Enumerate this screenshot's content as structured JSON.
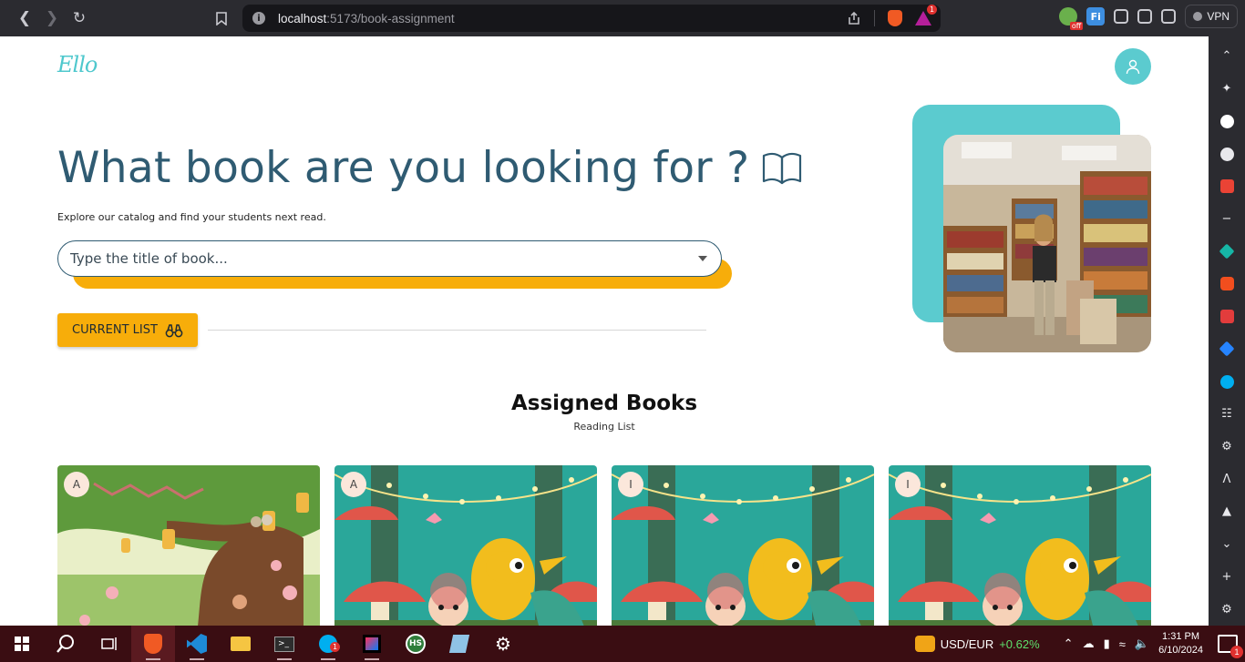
{
  "browser": {
    "url_host": "localhost",
    "url_rest": ":5173/book-assignment",
    "vpn_label": "VPN",
    "ext_off_badge": "off",
    "ext_fi_label": "Fi",
    "bat_badge": "1"
  },
  "app": {
    "logo": "Ello",
    "hero_title": "What book are you looking for ?",
    "hero_subtitle": "Explore our catalog and find your students next read.",
    "search_placeholder": "Type the title of book...",
    "current_list_label": "CURRENT LIST",
    "section_title": "Assigned Books",
    "section_subtitle": "Reading List",
    "books": [
      {
        "level": "A",
        "scene": "treehouse"
      },
      {
        "level": "A",
        "scene": "dragon"
      },
      {
        "level": "I",
        "scene": "dragon"
      },
      {
        "level": "I",
        "scene": "dragon"
      }
    ],
    "accent_teal": "#5bcbcf",
    "accent_yellow": "#f7ad0a",
    "title_color": "#2f5b72"
  },
  "taskbar": {
    "currency_pair": "USD/EUR",
    "currency_change": "+0.62%",
    "time": "1:31 PM",
    "date": "6/10/2024",
    "notification_count": "1",
    "skype_badge": "1"
  }
}
